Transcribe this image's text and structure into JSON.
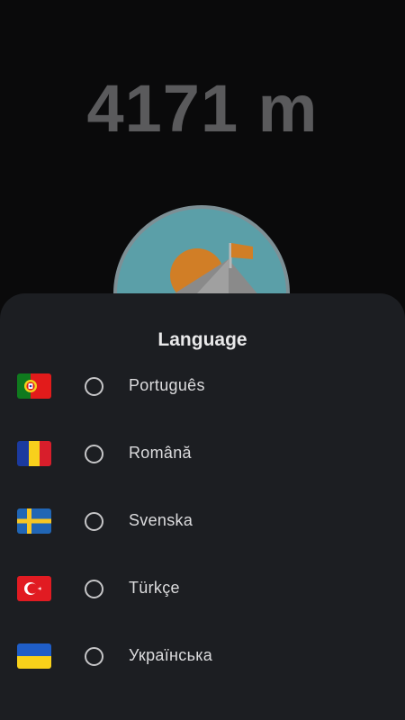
{
  "altitude": {
    "value": "4171 m"
  },
  "badge": {
    "icon": "mountain-summit-icon"
  },
  "language_sheet": {
    "title": "Language",
    "options": [
      {
        "label": "Português",
        "flag": "portugal-flag-icon",
        "selected": false
      },
      {
        "label": "Română",
        "flag": "romania-flag-icon",
        "selected": false
      },
      {
        "label": "Svenska",
        "flag": "sweden-flag-icon",
        "selected": false
      },
      {
        "label": "Türkçe",
        "flag": "turkey-flag-icon",
        "selected": false
      },
      {
        "label": "Українська",
        "flag": "ukraine-flag-icon",
        "selected": false
      }
    ]
  },
  "colors": {
    "background": "#0a0a0b",
    "sheet": "#1c1e22",
    "altitude_text": "#5a5a5c",
    "text": "#dcdcde"
  }
}
